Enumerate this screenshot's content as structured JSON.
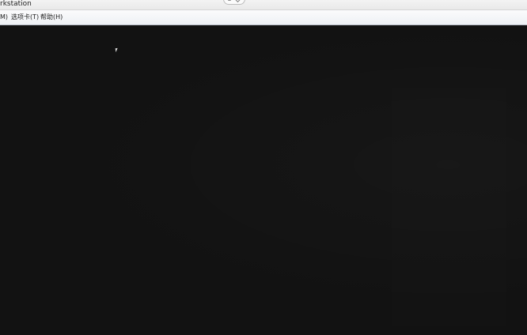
{
  "window": {
    "title": "rkstation"
  },
  "menubar": {
    "left_edge_label": "M)",
    "tabs_label": "选项卡(T)",
    "help_label": "帮助(H)"
  }
}
